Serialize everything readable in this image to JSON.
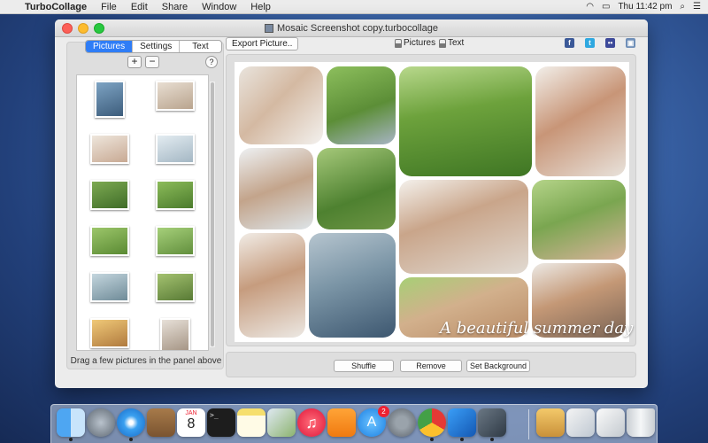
{
  "menubar": {
    "app_name": "TurboCollage",
    "items": [
      "File",
      "Edit",
      "Share",
      "Window",
      "Help"
    ],
    "clock": "Thu 11:42 pm"
  },
  "window": {
    "title": "Mosaic Screenshot copy.turbocollage"
  },
  "left_panel": {
    "tabs": [
      "Pictures",
      "Settings",
      "Text"
    ],
    "active_tab": "Pictures",
    "add_label": "+",
    "remove_label": "−",
    "help_label": "?",
    "hint": "Drag a few pictures in the panel above"
  },
  "toolbar": {
    "export_label": "Export Picture..",
    "lock_pictures_label": "Pictures",
    "lock_text_label": "Text",
    "social_icons": [
      "facebook-icon",
      "twitter-icon",
      "flickr-icon",
      "share-icon"
    ]
  },
  "canvas": {
    "overlay_text": "A beautiful summer day"
  },
  "bottom_buttons": {
    "shuffle": "Shuffle",
    "remove": "Remove",
    "set_background": "Set Background"
  },
  "dock": {
    "calendar_month": "JAN",
    "calendar_day": "8",
    "app_store_badge": "2",
    "icons": [
      "finder-icon",
      "launchpad-icon",
      "safari-icon",
      "contacts-icon",
      "calendar-icon",
      "terminal-icon",
      "notes-icon",
      "preview-icon",
      "itunes-icon",
      "ibooks-icon",
      "app-store-icon",
      "system-preferences-icon",
      "chrome-icon",
      "xcode-icon",
      "photo-booth-icon",
      "archive-icon",
      "documents-icon",
      "downloads-icon",
      "trash-icon"
    ]
  },
  "colors": {
    "accent": "#2f7df6",
    "close": "#fc5f57",
    "minimize": "#fdbc2e",
    "maximize": "#28c840"
  }
}
